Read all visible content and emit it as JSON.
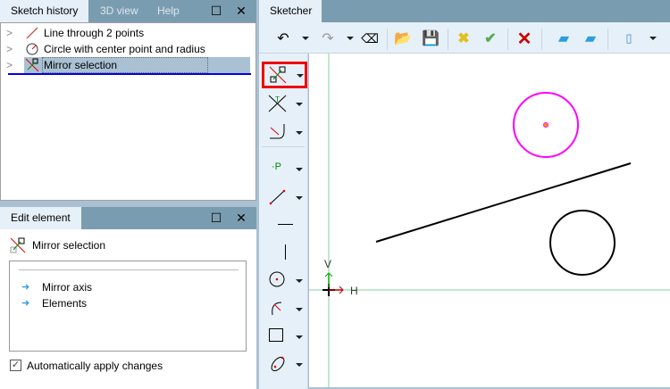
{
  "history_panel": {
    "tabs": [
      "Sketch history",
      "3D view",
      "Help"
    ],
    "items": [
      {
        "label": "Line through 2 points",
        "icon": "line-icon"
      },
      {
        "label": "Circle with center point and radius",
        "icon": "circle-icon"
      },
      {
        "label": "Mirror selection",
        "icon": "mirror-icon",
        "selected": true
      }
    ]
  },
  "edit_panel": {
    "title": "Edit element",
    "element": "Mirror selection",
    "params": [
      "Mirror axis",
      "Elements"
    ],
    "auto_apply_label": "Automatically apply changes",
    "auto_apply": true
  },
  "sketcher": {
    "tab": "Sketcher",
    "axis_h": "H",
    "axis_v": "V"
  },
  "colors": {
    "accent": "#ff00ff",
    "axis": "#7fd09a",
    "selection_border": "#ff0000"
  }
}
